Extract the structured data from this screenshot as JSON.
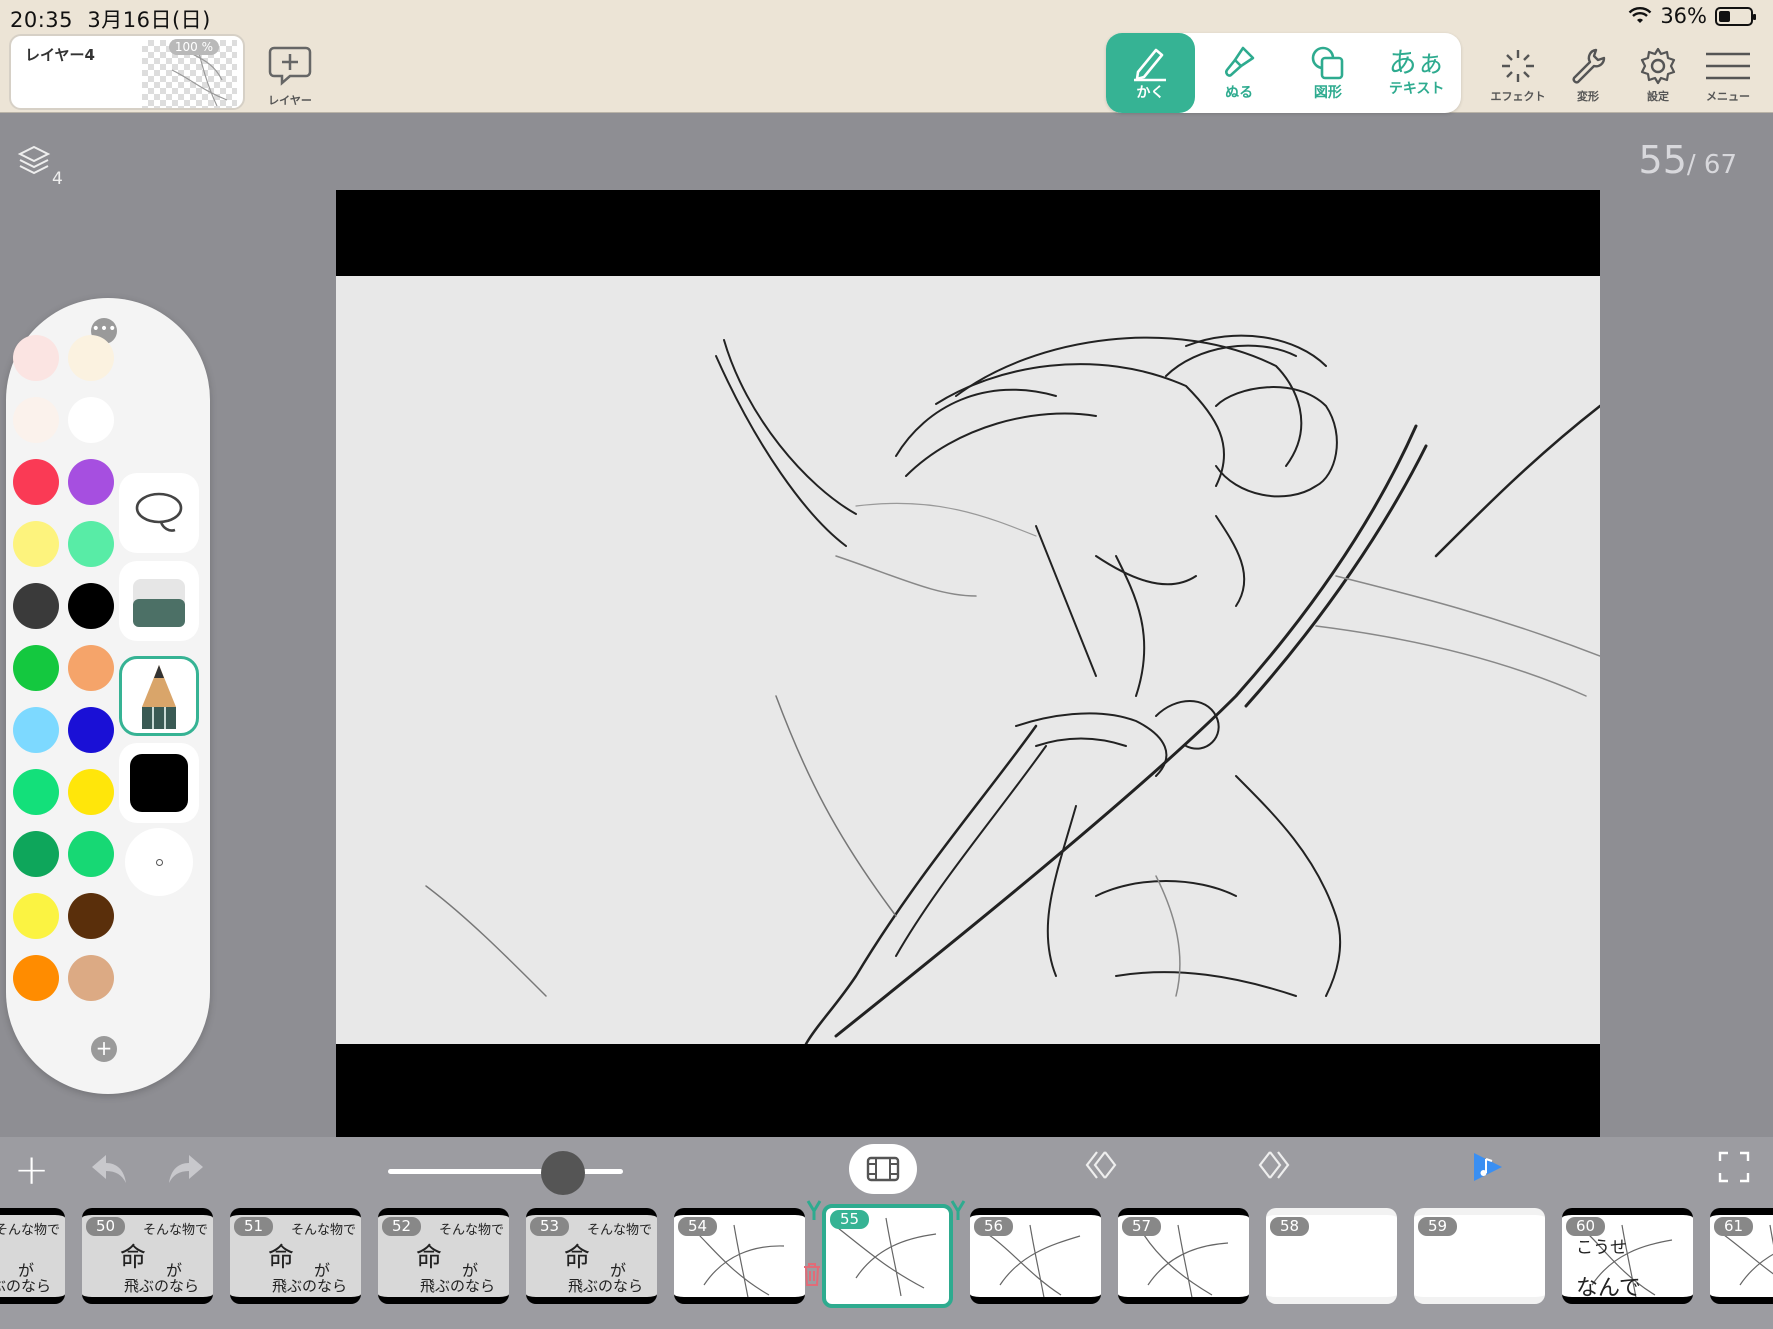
{
  "status": {
    "time": "20:35",
    "date": "3月16日(日)",
    "battery": "36%"
  },
  "layer": {
    "name": "レイヤー4",
    "opacity": "100 %",
    "add_label": "レイヤー"
  },
  "tools": [
    {
      "label": "かく",
      "icon": "pencil-icon"
    },
    {
      "label": "ぬる",
      "icon": "paint-brush-icon"
    },
    {
      "label": "図形",
      "icon": "shape-icon"
    },
    {
      "label": "テキスト",
      "big": "あぁ",
      "icon": "text-icon"
    }
  ],
  "right_tools": [
    {
      "label": "エフェクト",
      "icon": "sparkle-icon"
    },
    {
      "label": "変形",
      "icon": "wrench-icon"
    },
    {
      "label": "設定",
      "icon": "gear-icon"
    },
    {
      "label": "メニュー",
      "icon": "hamburger-icon"
    }
  ],
  "layers_count": "4",
  "page": {
    "current": "55",
    "total": "/ 67"
  },
  "palette": {
    "colors": [
      [
        "#fbe4e2",
        "#fbf2e0"
      ],
      [
        "#fbf2ec",
        "#ffffff"
      ],
      [
        "#fa3a55",
        "#a64fe0"
      ],
      [
        "#fdf37d",
        "#58eca6"
      ],
      [
        "#3a3a3a",
        "#000000"
      ],
      [
        "#14c83f",
        "#f5a46a"
      ],
      [
        "#7dd9ff",
        "#1a10d6"
      ],
      [
        "#13e07a",
        "#ffe60a"
      ],
      [
        "#0ea65b",
        "#17d874"
      ],
      [
        "#fbf342",
        "#5a2f0b"
      ],
      [
        "#ff8c00",
        "#dcaa84"
      ]
    ],
    "current_color": "#000000"
  },
  "frames": [
    {
      "num": "",
      "kind": "text"
    },
    {
      "num": "50",
      "kind": "text"
    },
    {
      "num": "51",
      "kind": "text"
    },
    {
      "num": "52",
      "kind": "text"
    },
    {
      "num": "53",
      "kind": "text"
    },
    {
      "num": "54",
      "kind": "sketch"
    },
    {
      "num": "55",
      "kind": "sketch",
      "current": true
    },
    {
      "num": "56",
      "kind": "sketch"
    },
    {
      "num": "57",
      "kind": "sketch"
    },
    {
      "num": "58",
      "kind": "blank"
    },
    {
      "num": "59",
      "kind": "blank"
    },
    {
      "num": "60",
      "kind": "sketch"
    },
    {
      "num": "61",
      "kind": "sketch"
    }
  ],
  "frame_text": {
    "a": "そんな物で",
    "b": "命",
    "c": "が",
    "d": "飛ぶのなら"
  },
  "frame60_text": {
    "a": "こうせ",
    "b": "なんで"
  }
}
